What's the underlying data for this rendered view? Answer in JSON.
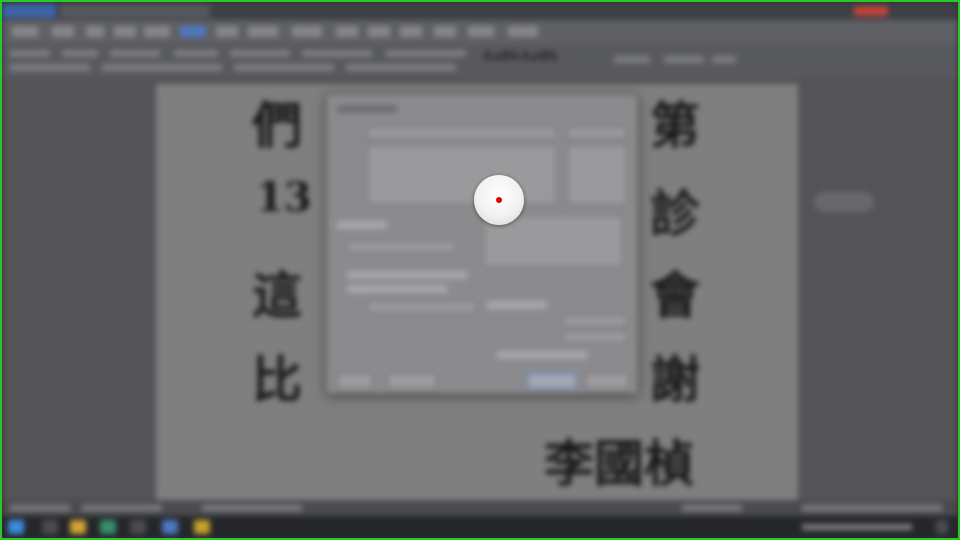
{
  "document": {
    "lines": [
      "們",
      "第",
      "13",
      "診",
      "這",
      "會",
      "比",
      "謝",
      "李國楨"
    ]
  },
  "ribbon": {
    "style_preview": "AaBbAaBb"
  },
  "colors": {
    "accent": "#4f78c2",
    "frame": "#28c828",
    "cursor_dot": "#e00000"
  },
  "icons": [
    "cursor-spotlight-icon",
    "start-icon",
    "windows-taskbar-icons"
  ]
}
